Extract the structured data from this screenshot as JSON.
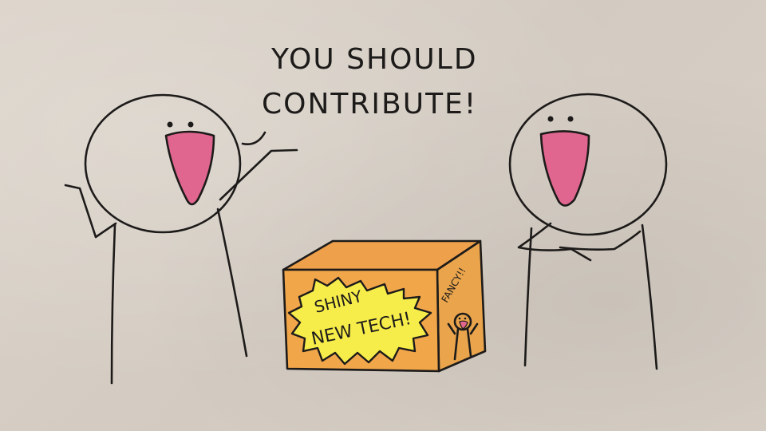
{
  "speech": {
    "line1": "YOU SHOULD",
    "line2": "CONTRIBUTE!"
  },
  "box": {
    "sticker_line1": "SHINY",
    "sticker_line2": "NEW TECH!",
    "side_label": "FANCY!!"
  },
  "colors": {
    "paper": "#d8d0c6",
    "ink": "#1d1b1a",
    "mouth": "#e0668f",
    "box_front": "#f1a64a",
    "box_top": "#eea14a",
    "box_side": "#e9a44c",
    "sticker": "#f7ed4a"
  }
}
